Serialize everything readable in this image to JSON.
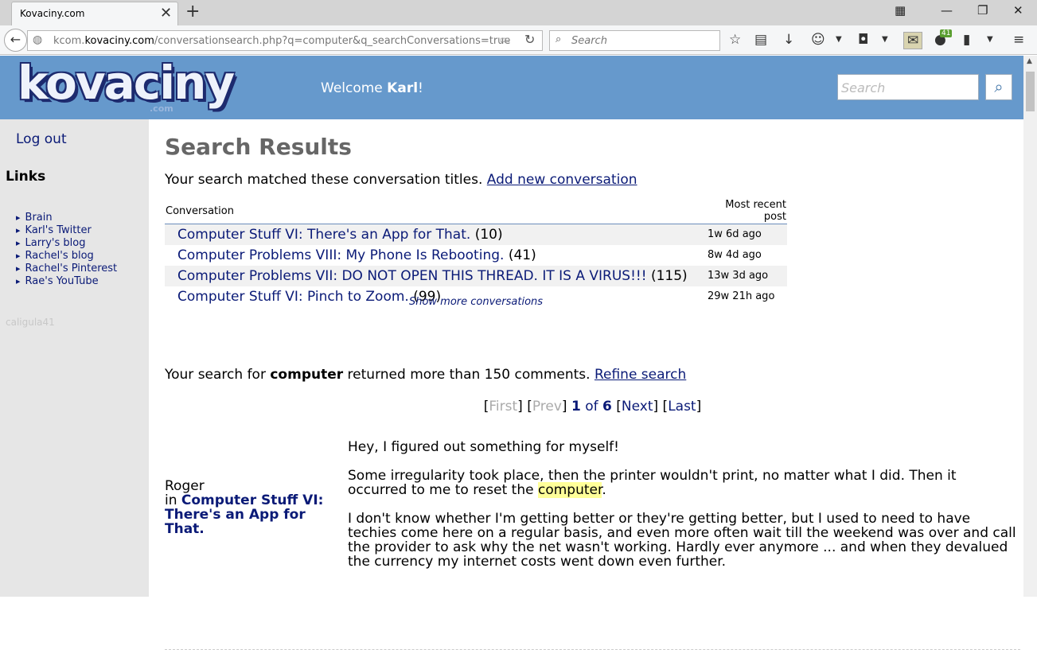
{
  "browser": {
    "tab_title": "Kovaciny.com",
    "url_prefix": "kcom.",
    "url_domain": "kovaciny.com",
    "url_path": "/conversationsearch.php?q=computer&q_searchConversations=true",
    "search_placeholder": "Search",
    "addon_badge": "41"
  },
  "header": {
    "logo_text": "kovaciny",
    "logo_suffix": ".com",
    "welcome_prefix": "Welcome ",
    "welcome_user": "Karl",
    "welcome_suffix": "!",
    "search_placeholder": "Search"
  },
  "sidebar": {
    "logout": "Log out",
    "links_heading": "Links",
    "links": [
      "Brain",
      "Karl's Twitter",
      "Larry's blog",
      "Rachel's blog",
      "Rachel's Pinterest",
      "Rae's YouTube"
    ],
    "username": "caligula41"
  },
  "main": {
    "title": "Search Results",
    "match_text": "Your search matched these conversation titles. ",
    "add_conversation": "Add new conversation",
    "table_headers": {
      "conversation": "Conversation",
      "recent": "Most recent post"
    },
    "conversations": [
      {
        "title": "Computer Stuff VI: There's an App for That.",
        "count": "(10)",
        "when": "1w 6d ago"
      },
      {
        "title": "Computer Problems VIII: My Phone Is Rebooting.",
        "count": "(41)",
        "when": "8w 4d ago"
      },
      {
        "title": "Computer Problems VII: DO NOT OPEN THIS THREAD. IT IS A VIRUS!!!",
        "count": "(115)",
        "when": "13w 3d ago"
      },
      {
        "title": "Computer Stuff VI: Pinch to Zoom.",
        "count": "(99)",
        "when": "29w 21h ago"
      }
    ],
    "show_more": "Show more conversations",
    "comment_prefix": "Your search for ",
    "comment_term": "computer",
    "comment_suffix": " returned more than 150 comments. ",
    "refine": "Refine search",
    "pager": {
      "first": "First",
      "prev": "Prev",
      "current": "1",
      "of": "of",
      "total": "6",
      "next": "Next",
      "last": "Last"
    }
  },
  "post": {
    "author": "Roger",
    "in_label": "in ",
    "thread": "Computer Stuff VI: There's an App for That.",
    "p1": "Hey, I figured out something for myself!",
    "p2_before": "Some irregularity took place, then the printer wouldn't print, no matter what I did. Then it occurred to me to reset the ",
    "p2_highlight": "computer",
    "p2_after": ".",
    "p3": "I don't know whether I'm getting better or they're getting better, but I used to need to have techies come here on a regular basis, and even more often wait till the weekend was over and call the provider to ask why the net wasn't working. Hardly ever anymore ... and when they devalued the currency my internet costs went down even further."
  }
}
